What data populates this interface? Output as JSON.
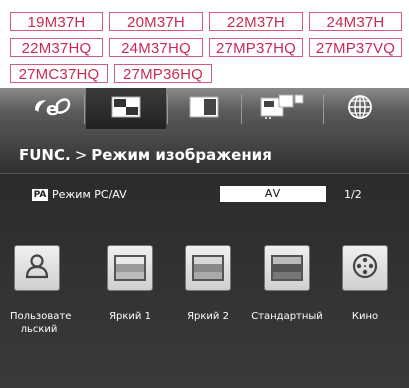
{
  "models": [
    [
      "19M37H",
      "20M37H",
      "22M37H",
      "24M37H"
    ],
    [
      "22M37HQ",
      "24M37HQ",
      "27MP37HQ",
      "27MP37VQ"
    ],
    [
      "27MC37HQ",
      "27MP36HQ"
    ]
  ],
  "tabs": [
    "eco-icon",
    "picture-icon",
    "screen-icon",
    "pip-icon",
    "globe-icon"
  ],
  "menu": {
    "func": "FUNC.",
    "arrow": ">",
    "section": "Режим изображения"
  },
  "setting": {
    "badge": "PA",
    "label": "Режим PC/AV",
    "value": "AV",
    "page": "1/2"
  },
  "modes": [
    {
      "label": "Пользовате льский",
      "icon": "user-icon"
    },
    {
      "label": "Яркий 1",
      "icon": "monitor-bright1-icon"
    },
    {
      "label": "Яркий 2",
      "icon": "monitor-bright2-icon"
    },
    {
      "label": "Стандартный",
      "icon": "monitor-standard-icon"
    },
    {
      "label": "Кино",
      "icon": "film-reel-icon"
    }
  ],
  "colors": {
    "accent": "#c92a55",
    "osd_bg": "#2e2e2e"
  }
}
